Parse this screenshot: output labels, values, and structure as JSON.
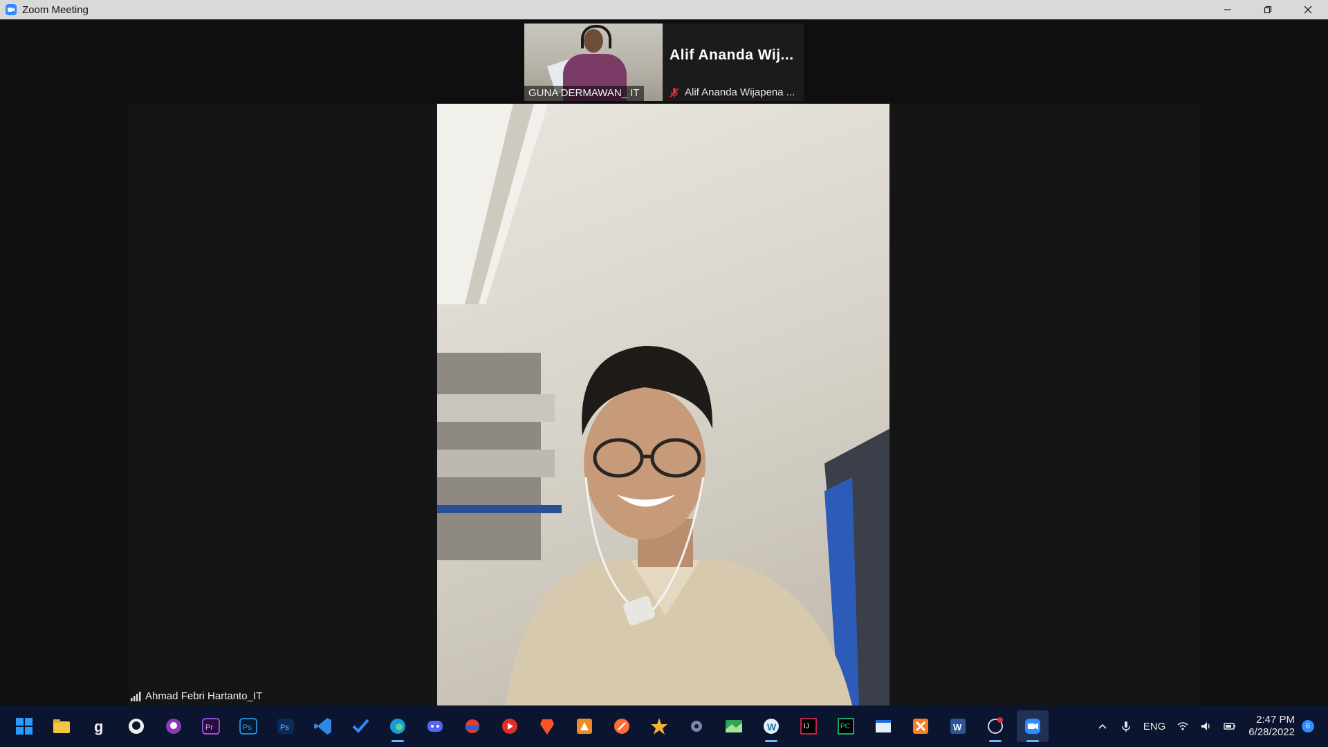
{
  "window": {
    "title": "Zoom Meeting"
  },
  "strip": {
    "participant1": {
      "name": "GUNA DERMAWAN_ IT"
    },
    "participant2": {
      "display_name": "Alif Ananda Wij...",
      "sub_name": "Alif Ananda Wijapena ..."
    }
  },
  "speaker": {
    "name": "Ahmad Febri Hartanto_IT"
  },
  "taskbar": {
    "icons": [
      "windows-start-icon",
      "file-explorer-icon",
      "app-g-icon",
      "github-icon",
      "github-desktop-icon",
      "premiere-icon",
      "photoshop-icon",
      "photoshop-alt-icon",
      "vscode-icon",
      "tasks-icon",
      "edge-icon",
      "discord-icon",
      "app-game-icon",
      "youtube-icon",
      "brave-icon",
      "app-orange-icon",
      "postman-icon",
      "app-star-icon",
      "app-gear-icon",
      "android-studio-icon",
      "wordpress-icon",
      "intellij-icon",
      "pycharm-icon",
      "app-window-icon",
      "xampp-icon",
      "word-icon",
      "chrome-debug-icon",
      "zoom-icon"
    ],
    "tray": {
      "language": "ENG",
      "time": "2:47 PM",
      "date": "6/28/2022",
      "notifications": "6"
    }
  },
  "colors": {
    "titlebar": "#d9d9d9",
    "background": "#0f0f0f",
    "taskbar": "#0b1530",
    "zoom_blue": "#2d8cff",
    "mic_muted": "#e0332f"
  }
}
